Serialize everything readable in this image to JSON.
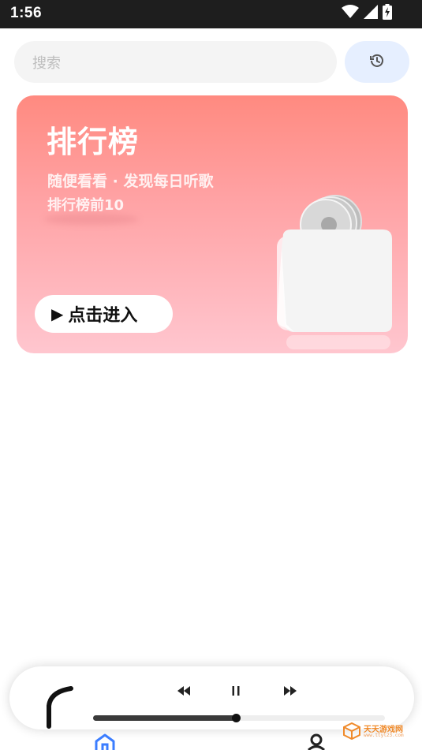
{
  "status_bar": {
    "time": "1:56",
    "icons": [
      "wifi-icon",
      "signal-icon",
      "battery-charging-icon"
    ]
  },
  "search": {
    "placeholder": "搜索",
    "history_icon": "history-icon"
  },
  "rank_card": {
    "title": "排行榜",
    "subtitle": "随便看看 · 发现每日听歌",
    "subtitle2": "排行榜前10",
    "button_label": "点击进入",
    "button_icon": "play-icon",
    "illustration": "cd-box-icon",
    "colors": {
      "top": "#ff8a80",
      "bottom": "#ffc6cf"
    }
  },
  "player": {
    "prev_icon": "rewind-icon",
    "pause_icon": "pause-icon",
    "next_icon": "fast-forward-icon",
    "progress_fraction": 0.49
  },
  "nav": {
    "items": [
      {
        "icon": "home-icon",
        "active": true,
        "color": "#3b7dff"
      },
      {
        "icon": "profile-icon",
        "active": false,
        "color": "#222222"
      }
    ]
  },
  "watermark": {
    "text": "天天游戏网",
    "url": "www.ttyl23.com"
  }
}
